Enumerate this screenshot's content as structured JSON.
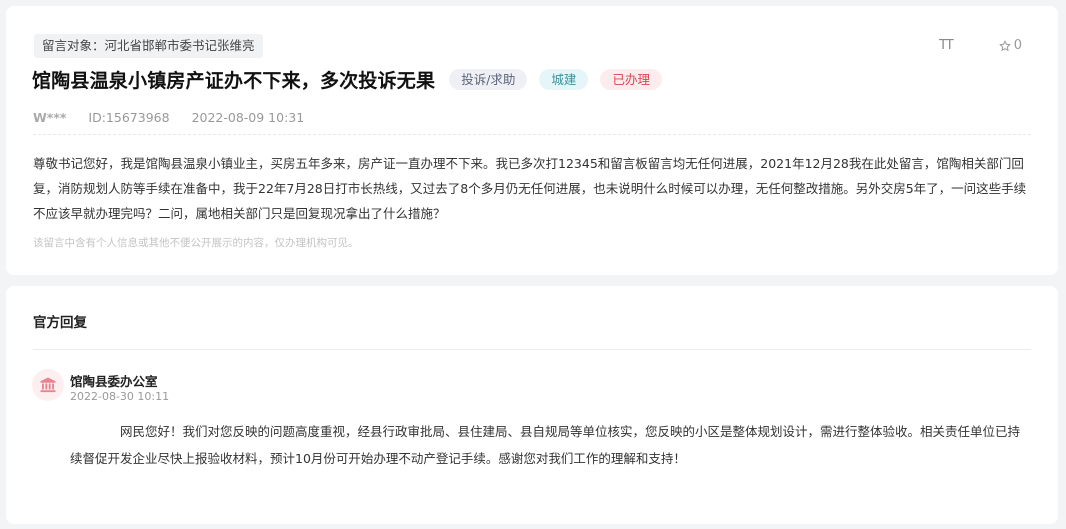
{
  "message": {
    "recipient": "留言对象：河北省邯郸市委书记张维亮",
    "font_tool": "TT",
    "favorite_count": "0",
    "title": "馆陶县温泉小镇房产证办不下来，多次投诉无果",
    "tags": {
      "category": "投诉/求助",
      "field": "城建",
      "status": "已办理"
    },
    "author": "W***",
    "id": "ID:15673968",
    "datetime": "2022-08-09 10:31",
    "content": "尊敬书记您好，我是馆陶县温泉小镇业主，买房五年多来，房产证一直办理不下来。我已多次打12345和留言板留言均无任何进展，2021年12月28我在此处留言，馆陶相关部门回复，消防规划人防等手续在准备中，我于22年7月28日打市长热线，又过去了8个多月仍无任何进展，也未说明什么时候可以办理，无任何整改措施。另外交房5年了，一问这些手续不应该早就办理完吗？二问，属地相关部门只是回复现况拿出了什么措施？",
    "notice": "该留言中含有个人信息或其他不便公开展示的内容，仅办理机构可见。"
  },
  "reply": {
    "section_title": "官方回复",
    "org_name": "馆陶县委办公室",
    "datetime": "2022-08-30 10:11",
    "content": "网民您好！我们对您反映的问题高度重视，经县行政审批局、县住建局、县自规局等单位核实，您反映的小区是整体规划设计，需进行整体验收。相关责任单位已持续督促开发企业尽快上报验收材料，预计10月份可开始办理不动产登记手续。感谢您对我们工作的理解和支持！"
  },
  "icons": {
    "font": "font-size-icon",
    "favorite": "star-outline-icon",
    "org": "government-building-icon"
  },
  "colors": {
    "status_red": "#d8464f",
    "field_teal": "#3e8f9c",
    "org_icon": "#e8838f"
  }
}
